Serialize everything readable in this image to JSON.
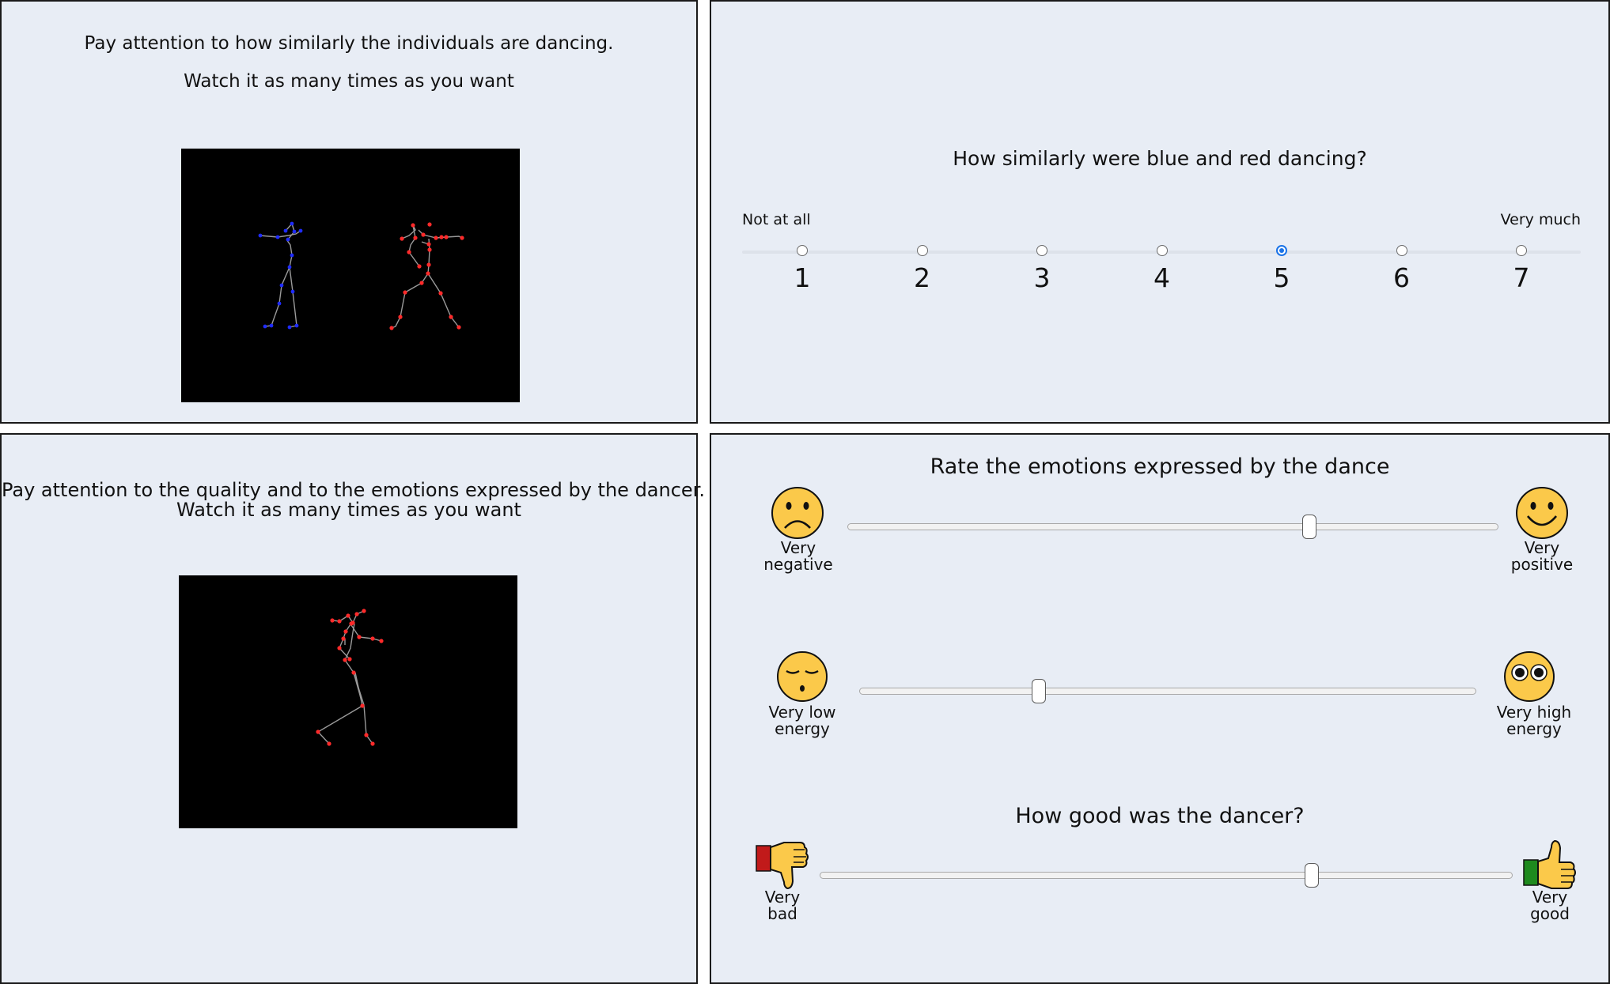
{
  "similarity_stimulus": {
    "instruction_line1": "Pay attention to how similarly the individuals are dancing.",
    "instruction_line2": "Watch it as many times as you want"
  },
  "similarity_question": {
    "question": "How similarly were blue and red dancing?",
    "min_label": "Not at all",
    "max_label": "Very much",
    "options": [
      "1",
      "2",
      "3",
      "4",
      "5",
      "6",
      "7"
    ],
    "selected": "5",
    "accent_color": "#1a73e8"
  },
  "quality_stimulus": {
    "instruction_line1": "Pay attention to the quality and to the emotions expressed by the dancer.",
    "instruction_line2": "Watch it as many times as you want"
  },
  "emotion_ratings": {
    "title": "Rate the emotions expressed by the dance",
    "valence": {
      "left_icon": "sad-face-icon",
      "left_line1": "Very",
      "left_line2": "negative",
      "right_icon": "happy-face-icon",
      "right_line1": "Very",
      "right_line2": "positive",
      "value": 0.71
    },
    "energy": {
      "left_icon": "sleepy-face-icon",
      "left_line1": "Very low",
      "left_line2": "energy",
      "right_icon": "wide-eyed-face-icon",
      "right_line1": "Very high",
      "right_line2": "energy",
      "value": 0.29
    },
    "quality_question": "How good was the dancer?",
    "quality": {
      "left_icon": "thumbs-down-icon",
      "left_line1": "Very",
      "left_line2": "bad",
      "right_icon": "thumbs-up-icon",
      "right_line1": "Very",
      "right_line2": "good",
      "value": 0.71
    },
    "face_color": "#fbc94a"
  }
}
